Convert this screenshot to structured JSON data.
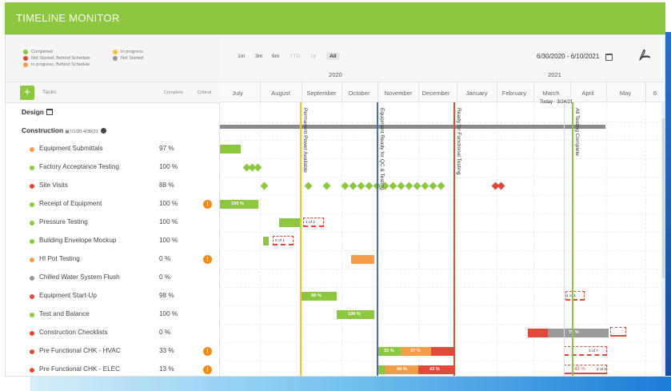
{
  "app": {
    "title": "TIMELINE MONITOR"
  },
  "legend": [
    {
      "label": "Completed",
      "color": "#8dc63f"
    },
    {
      "label": "In progress",
      "color": "#f4c430"
    },
    {
      "label": "Not Started, Behind Schedule",
      "color": "#e04a3a"
    },
    {
      "label": "Not Started",
      "color": "#999999"
    },
    {
      "label": "In progress, Behind Schedule",
      "color": "#f39c4a"
    }
  ],
  "task_header": {
    "add_label": "+",
    "tasks": "Tasks",
    "complete": "Complete",
    "critical": "Critical"
  },
  "toolbar": {
    "zoom": [
      "1m",
      "3m",
      "6m",
      "YTD",
      "1y",
      "All"
    ],
    "active_zoom": "All",
    "date_range": "6/30/2020 - 6/10/2021"
  },
  "timeline": {
    "years": [
      "2020",
      "2021"
    ],
    "months": [
      "July",
      "August",
      "September",
      "October",
      "November",
      "December",
      "January",
      "February",
      "March",
      "April",
      "May",
      "6"
    ],
    "today_label": "Today · 3/24/21"
  },
  "groups": {
    "design": {
      "name": "Design"
    },
    "construction": {
      "name": "Construction",
      "dates": "7/1/20-4/30/21"
    }
  },
  "milestones": [
    {
      "label": "Permanent Power Available",
      "color": "#f4c430"
    },
    {
      "label": "Equipment Ready for QC & Testing",
      "color": "#4a6fa5"
    },
    {
      "label": "Ready for Functional Testing",
      "color": "#e04a3a"
    },
    {
      "label": "All Testing Complete",
      "color": "#8dc63f"
    }
  ],
  "tasks": [
    {
      "name": "Equipment Submittals",
      "complete": "97 %",
      "status_color": "#f39c4a",
      "critical": false
    },
    {
      "name": "Factory Acceptance Testing",
      "complete": "100 %",
      "status_color": "#8dc63f",
      "critical": false
    },
    {
      "name": "Site Visits",
      "complete": "88 %",
      "status_color": "#e04a3a",
      "critical": false
    },
    {
      "name": "Receipt of Equipment",
      "complete": "100 %",
      "status_color": "#8dc63f",
      "critical": true,
      "bar_label": "100 %"
    },
    {
      "name": "Pressure Testing",
      "complete": "100 %",
      "status_color": "#8dc63f",
      "critical": false,
      "checklist": "1 of 1"
    },
    {
      "name": "Building Envelope Mockup",
      "complete": "100 %",
      "status_color": "#8dc63f",
      "critical": false,
      "checklist": "0 of 1"
    },
    {
      "name": "HI Pot Testing",
      "complete": "0 %",
      "status_color": "#f39c4a",
      "critical": true
    },
    {
      "name": "Chilled Water System Flush",
      "complete": "0 %",
      "status_color": "#999999",
      "critical": false
    },
    {
      "name": "Equipment Start-Up",
      "complete": "98 %",
      "status_color": "#e04a3a",
      "critical": false,
      "bar_label": "98 %",
      "checklist": "1 of 1"
    },
    {
      "name": "Test and Balance",
      "complete": "100 %",
      "status_color": "#8dc63f",
      "critical": false,
      "bar_label": "100 %"
    },
    {
      "name": "Construction Checklists",
      "complete": "0 %",
      "status_color": "#e04a3a",
      "critical": false,
      "bar_label": "75 %"
    },
    {
      "name": "Pre Functional CHK - HVAC",
      "complete": "33 %",
      "status_color": "#e04a3a",
      "critical": true,
      "bar_label": "33 %",
      "bar_label_2": "37 %",
      "checklist": "3 of 7"
    },
    {
      "name": "Pre Functional CHK - ELEC",
      "complete": "13 %",
      "status_color": "#e04a3a",
      "critical": true,
      "bar_label": "44 %",
      "bar_label_2": "43 %",
      "checklist": "2 of 2",
      "checklist_pct": "43 %"
    }
  ]
}
